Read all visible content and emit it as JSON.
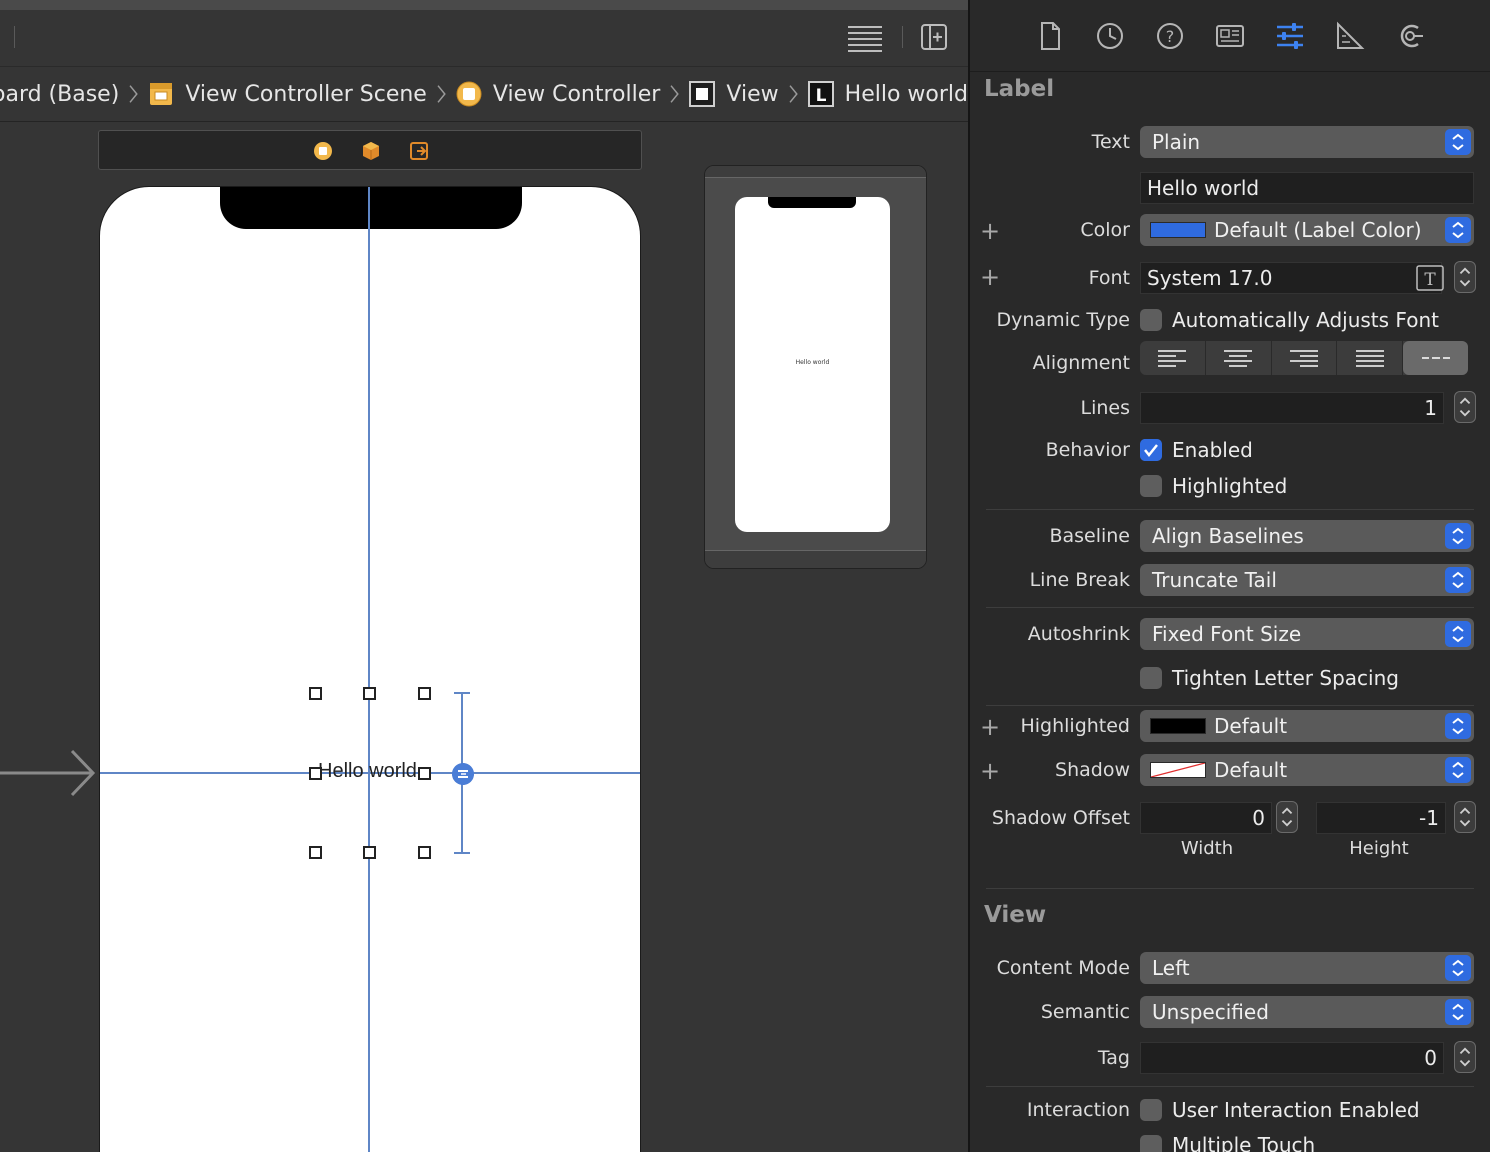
{
  "breadcrumb": {
    "items": [
      {
        "label": "oard (Base)",
        "icon": "storyboard-file"
      },
      {
        "label": "View Controller Scene",
        "icon": "scene-icon"
      },
      {
        "label": "View Controller",
        "icon": "view-controller-icon"
      },
      {
        "label": "View",
        "icon": "view-icon"
      },
      {
        "label": "Hello world",
        "icon": "label-icon"
      }
    ]
  },
  "canvas": {
    "label_text": "Hello world",
    "preview_label": "Hello world"
  },
  "inspector": {
    "tabs": [
      "file-inspector",
      "history-inspector",
      "quick-help",
      "identity-inspector",
      "attributes-inspector",
      "size-inspector",
      "connections-inspector"
    ],
    "label_section": {
      "title": "Label",
      "text_label": "Text",
      "text_type": "Plain",
      "text_value": "Hello world",
      "color_label": "Color",
      "color_value": "Default (Label Color)",
      "color_swatch": "#2f6be0",
      "font_label": "Font",
      "font_value": "System 17.0",
      "dynamic_type_label": "Dynamic Type",
      "dynamic_type_option": "Automatically Adjusts Font",
      "alignment_label": "Alignment",
      "lines_label": "Lines",
      "lines_value": "1",
      "behavior_label": "Behavior",
      "enabled_label": "Enabled",
      "highlighted_check_label": "Highlighted",
      "baseline_label": "Baseline",
      "baseline_value": "Align Baselines",
      "line_break_label": "Line Break",
      "line_break_value": "Truncate Tail",
      "autoshrink_label": "Autoshrink",
      "autoshrink_value": "Fixed Font Size",
      "tighten_label": "Tighten Letter Spacing",
      "highlighted_label": "Highlighted",
      "highlighted_value": "Default",
      "shadow_label": "Shadow",
      "shadow_value": "Default",
      "shadow_offset_label": "Shadow Offset",
      "shadow_width": "0",
      "shadow_height": "-1",
      "width_label": "Width",
      "height_label": "Height"
    },
    "view_section": {
      "title": "View",
      "content_mode_label": "Content Mode",
      "content_mode_value": "Left",
      "semantic_label": "Semantic",
      "semantic_value": "Unspecified",
      "tag_label": "Tag",
      "tag_value": "0",
      "interaction_label": "Interaction",
      "user_interaction": "User Interaction Enabled",
      "multiple_touch": "Multiple Touch"
    }
  }
}
